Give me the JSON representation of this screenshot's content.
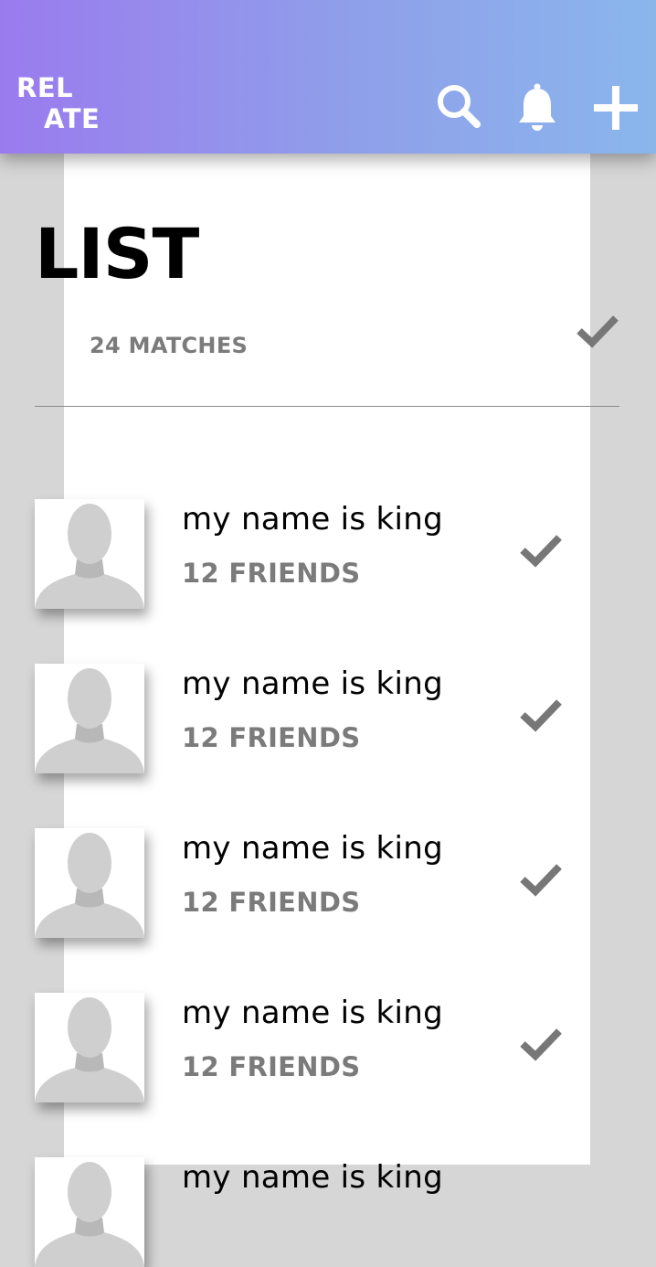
{
  "app": {
    "logo_line1": "REL",
    "logo_line2": "ATE",
    "gradient_start": "#9a7bee",
    "gradient_end": "#8ab6ec"
  },
  "header_icons": [
    "search-icon",
    "bell-icon",
    "plus-icon"
  ],
  "page": {
    "title": "LIST",
    "matches": "24 MATCHES"
  },
  "items": [
    {
      "name": "my name is king",
      "friends": "12 FRIENDS"
    },
    {
      "name": "my name is king",
      "friends": "12 FRIENDS"
    },
    {
      "name": "my name is king",
      "friends": "12 FRIENDS"
    },
    {
      "name": "my name is king",
      "friends": "12 FRIENDS"
    },
    {
      "name": "my name is king",
      "friends": ""
    }
  ],
  "colors": {
    "check": "#777777",
    "secondary_text": "#7b7b7b",
    "background": "#d6d6d6"
  }
}
